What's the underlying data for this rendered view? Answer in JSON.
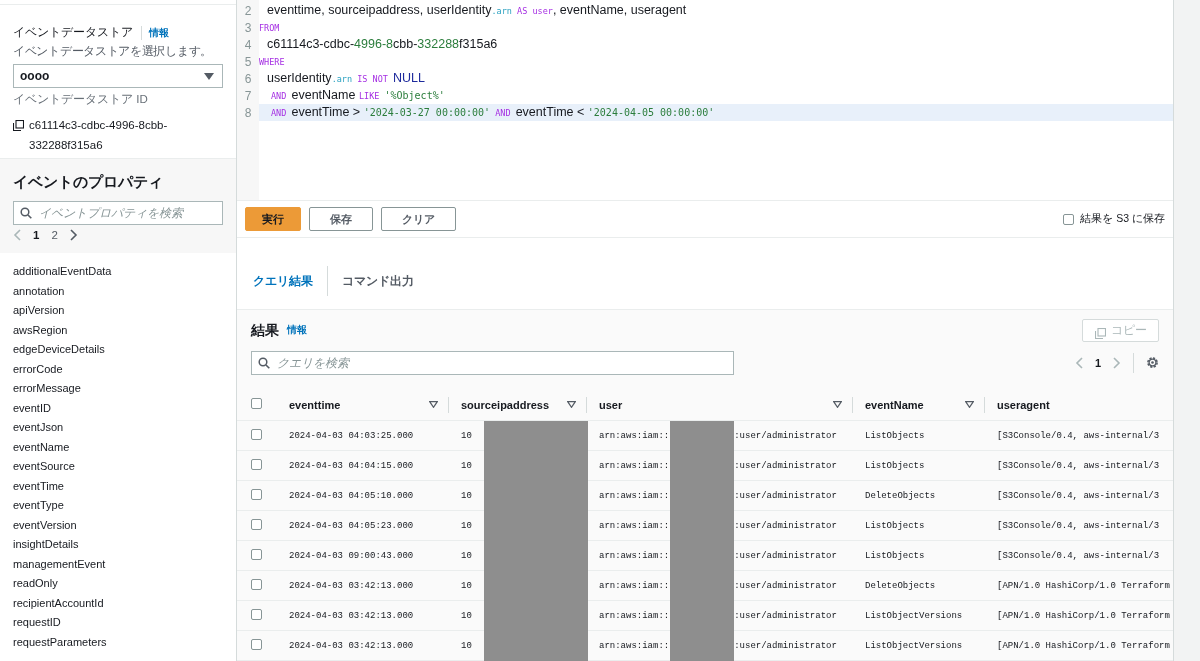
{
  "sidebar": {
    "store": {
      "label": "イベントデータストア",
      "info": "情報",
      "description": "イベントデータストアを選択します。",
      "value": "oooo",
      "id_label": "イベントデータストア ID",
      "id": "c61114c3-cdbc-4996-8cbb-332288f315a6"
    },
    "properties": {
      "title": "イベントのプロパティ",
      "search": {
        "placeholder": "イベントプロパティを検索"
      },
      "pages": [
        {
          "label": "1",
          "selected": true
        },
        {
          "label": "2",
          "selected": false
        }
      ],
      "items": [
        "additionalEventData",
        "annotation",
        "apiVersion",
        "awsRegion",
        "edgeDeviceDetails",
        "errorCode",
        "errorMessage",
        "eventID",
        "eventJson",
        "eventName",
        "eventSource",
        "eventTime",
        "eventType",
        "eventVersion",
        "insightDetails",
        "managementEvent",
        "readOnly",
        "recipientAccountId",
        "requestID",
        "requestParameters"
      ]
    }
  },
  "editor": {
    "lines": [
      {
        "number": "2",
        "kind": "body",
        "selected": false,
        "tokens": [
          {
            "kind": "plain",
            "text": "eventtime, sourceipaddress, userIdentity"
          },
          {
            "kind": "prop",
            "text": ".arn"
          },
          {
            "kind": "keyword",
            "text": " AS "
          },
          {
            "kind": "keyword",
            "text": "user"
          },
          {
            "kind": "plain",
            "text": ", eventName, useragent"
          }
        ]
      },
      {
        "number": "3",
        "kind": "clause",
        "selected": false,
        "tokens": [
          {
            "kind": "keyword",
            "text": "FROM"
          }
        ]
      },
      {
        "number": "4",
        "kind": "body",
        "selected": false,
        "tokens": [
          {
            "kind": "plain",
            "text": "c61114c3-cdbc-"
          },
          {
            "kind": "number",
            "text": "4996-8"
          },
          {
            "kind": "plain",
            "text": "cbb-"
          },
          {
            "kind": "number",
            "text": "332288"
          },
          {
            "kind": "plain",
            "text": "f315a6"
          }
        ]
      },
      {
        "number": "5",
        "kind": "clause",
        "selected": false,
        "tokens": [
          {
            "kind": "keyword",
            "text": "WHERE"
          }
        ]
      },
      {
        "number": "6",
        "kind": "body",
        "selected": false,
        "tokens": [
          {
            "kind": "plain",
            "text": "userIdentity"
          },
          {
            "kind": "prop",
            "text": ".arn"
          },
          {
            "kind": "keyword",
            "text": " IS NOT "
          },
          {
            "kind": "null",
            "text": "NULL"
          }
        ]
      },
      {
        "number": "7",
        "kind": "condition",
        "selected": false,
        "tokens": [
          {
            "kind": "keyword",
            "text": "AND "
          },
          {
            "kind": "plain",
            "text": "eventName "
          },
          {
            "kind": "keyword",
            "text": "LIKE "
          },
          {
            "kind": "string",
            "text": "'%Object%'"
          }
        ]
      },
      {
        "number": "8",
        "kind": "condition",
        "selected": true,
        "tokens": [
          {
            "kind": "keyword",
            "text": "AND "
          },
          {
            "kind": "plain",
            "text": "eventTime > "
          },
          {
            "kind": "string",
            "text": "'2024-03-27 00:00:00'"
          },
          {
            "kind": "keyword",
            "text": " AND "
          },
          {
            "kind": "plain",
            "text": "eventTime < "
          },
          {
            "kind": "string",
            "text": "'2024-04-05 00:00:00'"
          }
        ]
      }
    ]
  },
  "actions": [
    {
      "label": "実行",
      "kind": "primary"
    },
    {
      "label": "保存",
      "kind": "normal"
    },
    {
      "label": "クリア",
      "kind": "normal"
    }
  ],
  "save_to_s3": {
    "label": "結果を S3 に保存",
    "checked": false
  },
  "tabs": [
    {
      "label": "クエリ結果",
      "selected": true
    },
    {
      "label": "コマンド出力",
      "selected": false
    }
  ],
  "results": {
    "title": "結果",
    "info": "情報",
    "copy": "コピー",
    "search": {
      "placeholder": "クエリを検索"
    },
    "page": "1",
    "select_all_checked": false,
    "columns": [
      "eventtime",
      "sourceipaddress",
      "user",
      "eventName",
      "useragent"
    ],
    "rows": [
      {
        "checked": false,
        "eventtime": "2024-04-03 04:03:25.000",
        "sourceipaddress": "10",
        "user_prefix": "arn:aws:iam::",
        "user_suffix": ":user/administrator",
        "redacted": true,
        "eventName": "ListObjects",
        "useragent": "[S3Console/0.4, aws-internal/3"
      },
      {
        "checked": false,
        "eventtime": "2024-04-03 04:04:15.000",
        "sourceipaddress": "10",
        "user_prefix": "arn:aws:iam::",
        "user_suffix": ":user/administrator",
        "redacted": true,
        "eventName": "ListObjects",
        "useragent": "[S3Console/0.4, aws-internal/3"
      },
      {
        "checked": false,
        "eventtime": "2024-04-03 04:05:10.000",
        "sourceipaddress": "10",
        "user_prefix": "arn:aws:iam::",
        "user_suffix": ":user/administrator",
        "redacted": true,
        "eventName": "DeleteObjects",
        "useragent": "[S3Console/0.4, aws-internal/3"
      },
      {
        "checked": false,
        "eventtime": "2024-04-03 04:05:23.000",
        "sourceipaddress": "10",
        "user_prefix": "arn:aws:iam::",
        "user_suffix": ":user/administrator",
        "redacted": true,
        "eventName": "ListObjects",
        "useragent": "[S3Console/0.4, aws-internal/3"
      },
      {
        "checked": false,
        "eventtime": "2024-04-03 09:00:43.000",
        "sourceipaddress": "10",
        "user_prefix": "arn:aws:iam::",
        "user_suffix": ":user/administrator",
        "redacted": true,
        "eventName": "ListObjects",
        "useragent": "[S3Console/0.4, aws-internal/3"
      },
      {
        "checked": false,
        "eventtime": "2024-04-03 03:42:13.000",
        "sourceipaddress": "10",
        "user_prefix": "arn:aws:iam::",
        "user_suffix": ":user/administrator",
        "redacted": true,
        "eventName": "DeleteObjects",
        "useragent": "[APN/1.0 HashiCorp/1.0 Terraform"
      },
      {
        "checked": false,
        "eventtime": "2024-04-03 03:42:13.000",
        "sourceipaddress": "10",
        "user_prefix": "arn:aws:iam::",
        "user_suffix": ":user/administrator",
        "redacted": true,
        "eventName": "ListObjectVersions",
        "useragent": "[APN/1.0 HashiCorp/1.0 Terraform"
      },
      {
        "checked": false,
        "eventtime": "2024-04-03 03:42:13.000",
        "sourceipaddress": "10",
        "user_prefix": "arn:aws:iam::",
        "user_suffix": ":user/administrator",
        "redacted": true,
        "eventName": "ListObjectVersions",
        "useragent": "[APN/1.0 HashiCorp/1.0 Terraform"
      }
    ]
  }
}
